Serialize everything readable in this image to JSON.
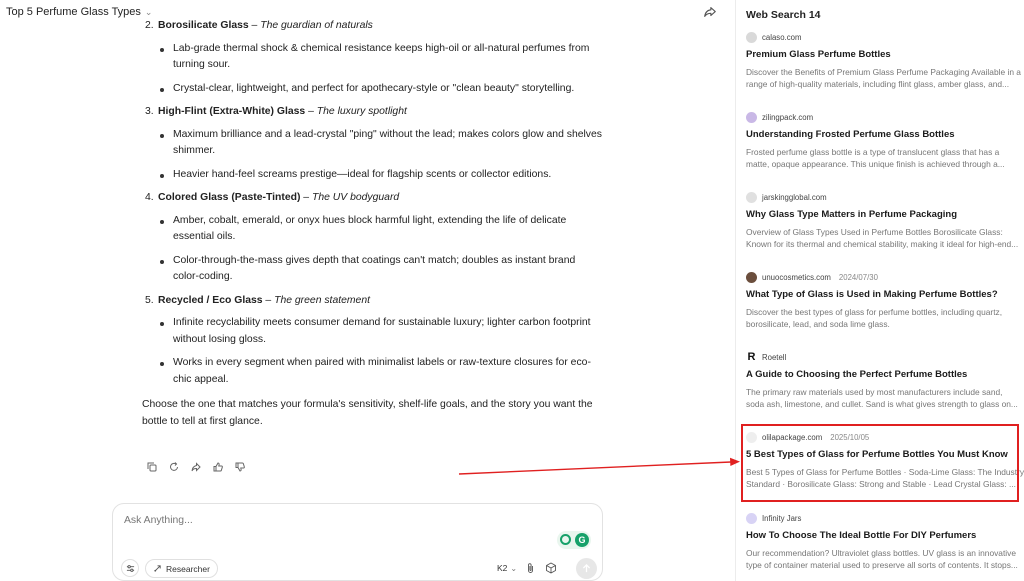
{
  "header": {
    "title": "Top 5 Perfume Glass Types"
  },
  "content": {
    "items": [
      {
        "num": "2.",
        "name": "Borosilicate Glass",
        "sep": " – ",
        "tagline": "The guardian of naturals",
        "bullets": [
          "Lab-grade thermal shock & chemical resistance keeps high-oil or all-natural perfumes from turning sour.",
          "Crystal-clear, lightweight, and perfect for apothecary-style or \"clean beauty\" storytelling."
        ]
      },
      {
        "num": "3.",
        "name": "High-Flint (Extra-White) Glass",
        "sep": " – ",
        "tagline": "The luxury spotlight",
        "bullets": [
          "Maximum brilliance and a lead-crystal \"ping\" without the lead; makes colors glow and shelves shimmer.",
          "Heavier hand-feel screams prestige—ideal for flagship scents or collector editions."
        ]
      },
      {
        "num": "4.",
        "name": "Colored Glass (Paste-Tinted)",
        "sep": " – ",
        "tagline": "The UV bodyguard",
        "bullets": [
          "Amber, cobalt, emerald, or onyx hues block harmful light, extending the life of delicate essential oils.",
          "Color-through-the-mass gives depth that coatings can't match; doubles as instant brand color-coding."
        ]
      },
      {
        "num": "5.",
        "name": "Recycled / Eco Glass",
        "sep": " – ",
        "tagline": "The green statement",
        "bullets": [
          "Infinite recyclability meets consumer demand for sustainable luxury; lighter carbon footprint without losing gloss.",
          "Works in every segment when paired with minimalist labels or raw-texture closures for eco-chic appeal."
        ]
      }
    ],
    "conclusion": "Choose the one that matches your formula's sensitivity, shelf-life goals, and the story you want the bottle to tell at first glance."
  },
  "input": {
    "placeholder": "Ask Anything...",
    "researcher_label": "Researcher",
    "model_label": "K2"
  },
  "panel": {
    "title": "Web Search 14",
    "results": [
      {
        "source": "calaso.com",
        "date": "",
        "title": "Premium Glass Perfume Bottles",
        "desc1": "Discover the Benefits of Premium Glass Perfume Packaging Available in a",
        "desc2": "range of high-quality materials, including flint glass, amber glass, and..."
      },
      {
        "source": "zilingpack.com",
        "date": "",
        "title": "Understanding Frosted Perfume Glass Bottles",
        "desc1": "Frosted perfume glass bottle is a type of translucent glass that has a",
        "desc2": "matte, opaque appearance. This unique finish is achieved through a..."
      },
      {
        "source": "jarskingglobal.com",
        "date": "",
        "title": "Why Glass Type Matters in Perfume Packaging",
        "desc1": "Overview of Glass Types Used in Perfume Bottles Borosilicate Glass:",
        "desc2": "Known for its thermal and chemical stability, making it ideal for high-end..."
      },
      {
        "source": "unuocosmetics.com",
        "date": "2024/07/30",
        "title": "What Type of Glass is Used in Making Perfume Bottles?",
        "desc1": "Discover the best types of glass for perfume bottles, including quartz,",
        "desc2": "borosilicate, lead, and soda lime glass."
      },
      {
        "source": "Roetell",
        "date": "",
        "title": "A Guide to Choosing the Perfect Perfume Bottles",
        "desc1": "The primary raw materials used by most manufacturers include sand,",
        "desc2": "soda ash, limestone, and cullet. Sand is what gives strength to glass on..."
      },
      {
        "source": "olilapackage.com",
        "date": "2025/10/05",
        "title": "5 Best Types of Glass for Perfume Bottles You Must Know",
        "desc1": "Best 5 Types of Glass for Perfume Bottles · Soda-Lime Glass: The Industry",
        "desc2": "Standard · Borosilicate Glass: Strong and Stable · Lead Crystal Glass: ..."
      },
      {
        "source": "Infinity Jars",
        "date": "",
        "title": "How To Choose The Ideal Bottle For DIY Perfumers",
        "desc1": "Our recommendation? Ultraviolet glass bottles. UV glass is an innovative",
        "desc2": "type of container material used to preserve all sorts of contents. It stops..."
      }
    ]
  },
  "colors": {
    "highlight": "#e02020",
    "grammarly": "#17a16a"
  }
}
